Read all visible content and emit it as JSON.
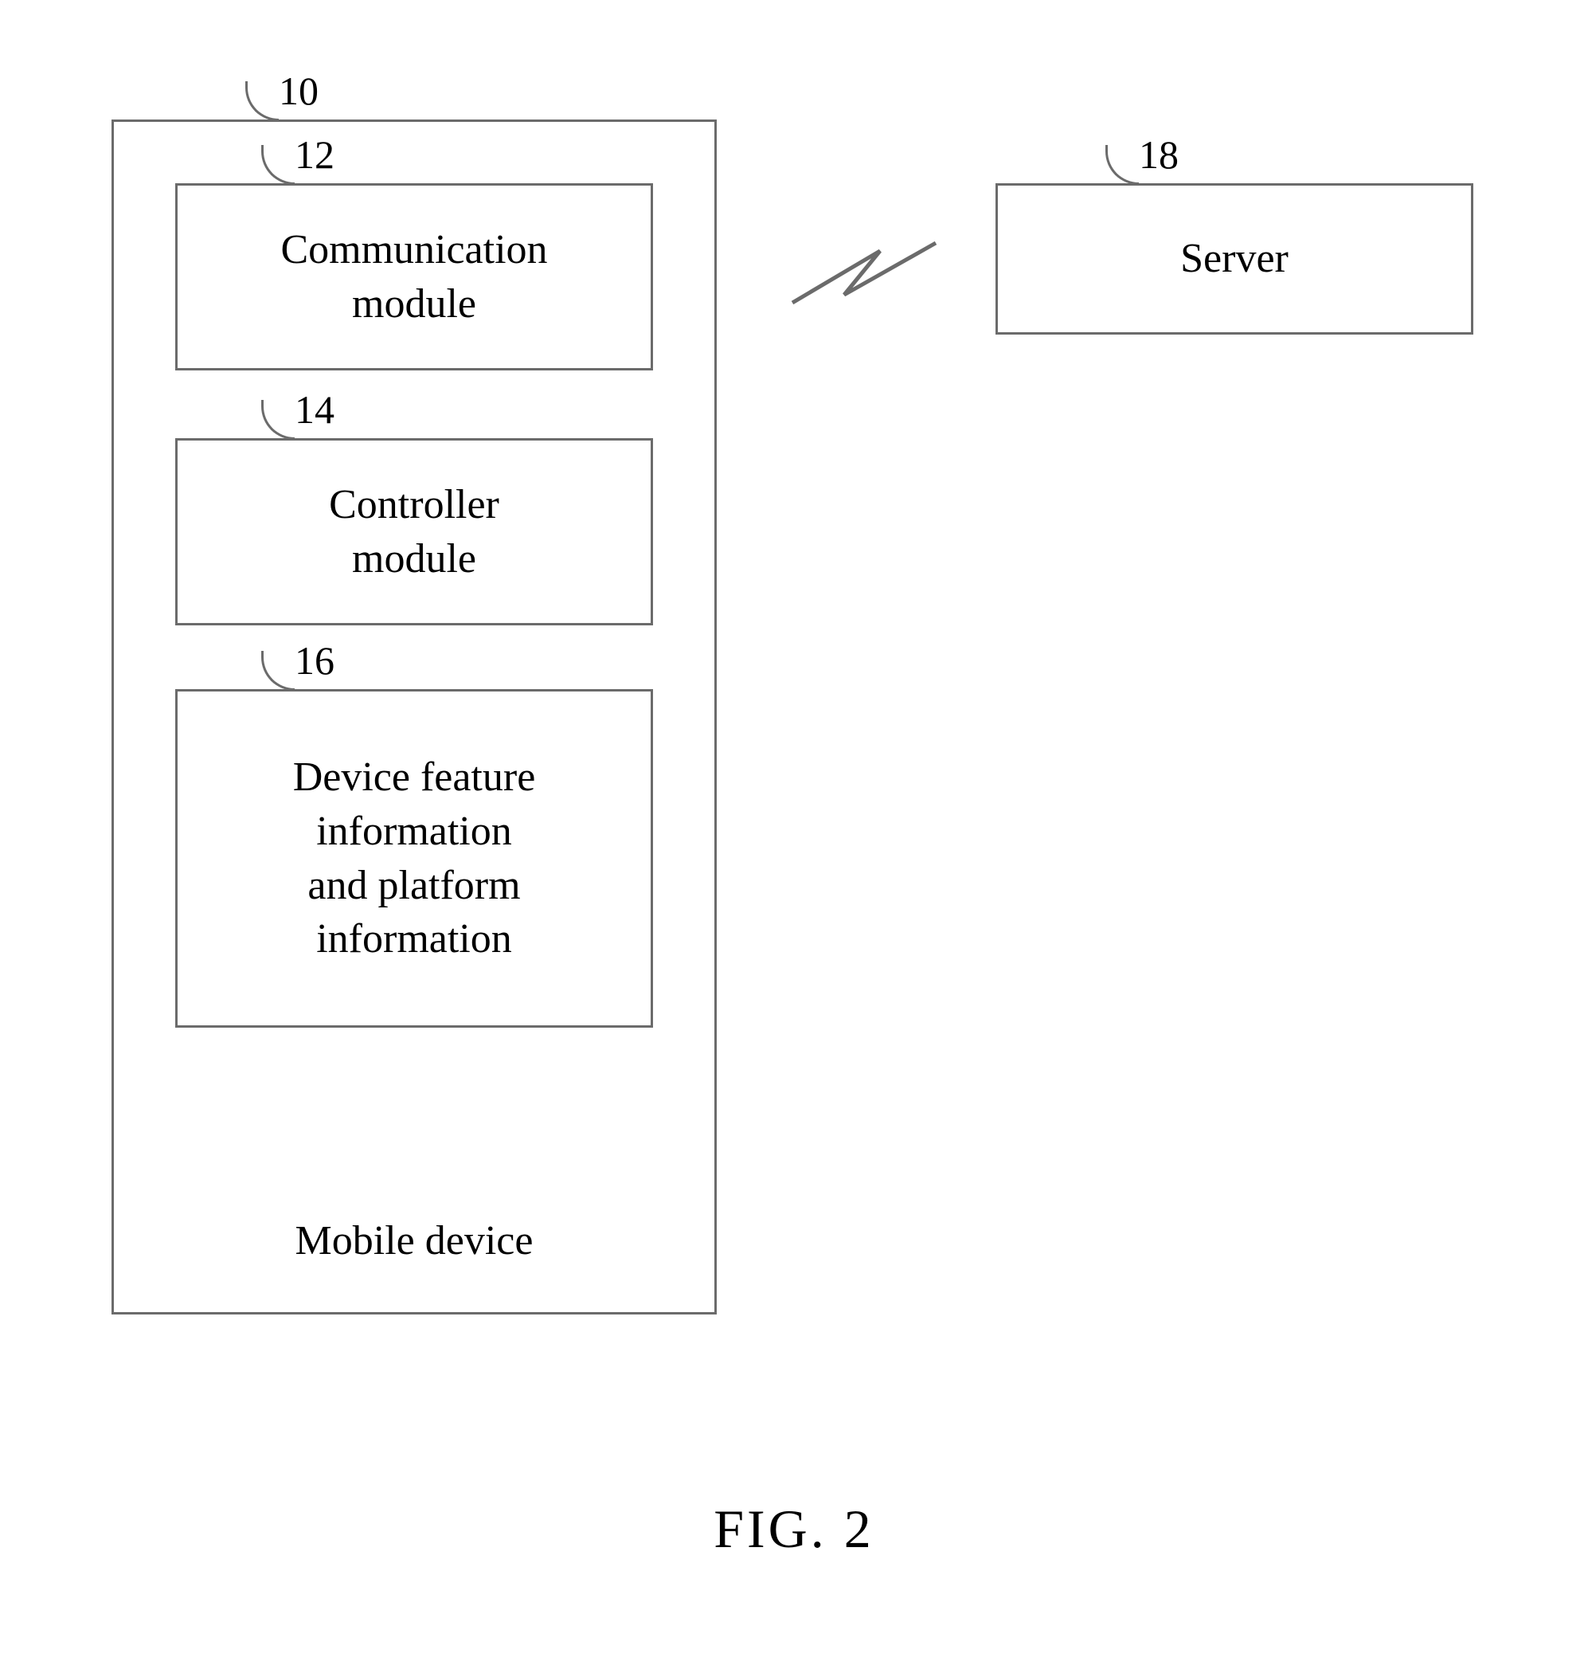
{
  "diagram": {
    "mobile_device": {
      "ref": "10",
      "label": "Mobile device",
      "modules": {
        "communication": {
          "ref": "12",
          "label": "Communication\nmodule"
        },
        "controller": {
          "ref": "14",
          "label": "Controller\nmodule"
        },
        "feature_info": {
          "ref": "16",
          "label": "Device feature\ninformation\nand platform\ninformation"
        }
      }
    },
    "server": {
      "ref": "18",
      "label": "Server"
    },
    "link_type": "wireless"
  },
  "figure_caption": "FIG.  2"
}
